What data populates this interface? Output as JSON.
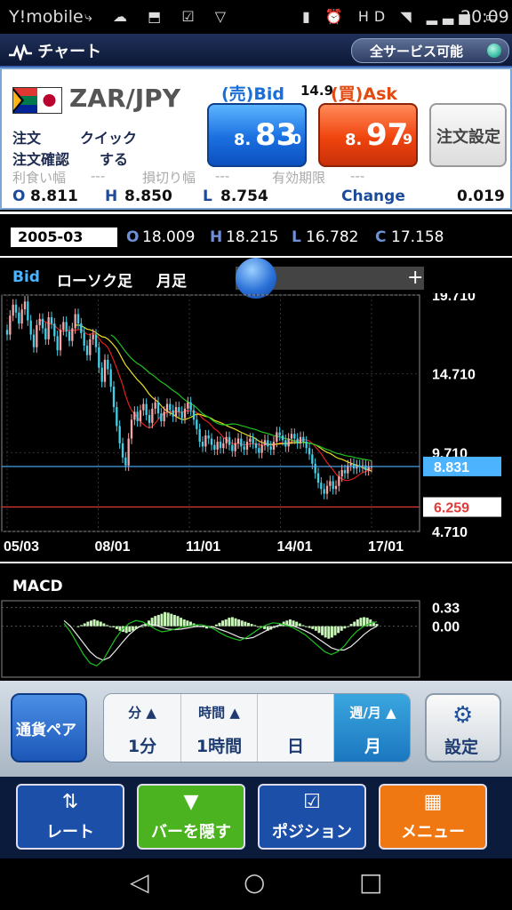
{
  "status_bar": {
    "carrier": "Y!mobile",
    "time": "20:09",
    "left_icons": "⤷ ☁ ⬒ ☑ ▽",
    "right_icons": "▮ ⏰ HD ◥ ▂▃▅ ▭"
  },
  "title_bar": {
    "title": "チャート",
    "service_status": "全サービス可能"
  },
  "quote": {
    "pair": "ZAR/JPY",
    "bid_label": "(売)Bid",
    "ask_label": "(買)Ask",
    "spread": "14.9",
    "bid_p1": "8.",
    "bid_p2": "83",
    "bid_p3": "0",
    "ask_p1": "8.",
    "ask_p2": "97",
    "ask_p3": "9",
    "order_settings": "注文設定",
    "order_label": "注文",
    "order_value": "クイック",
    "confirm_label": "注文確認",
    "confirm_value": "する",
    "takeprofit_label": "利食い幅",
    "takeprofit_value": "---",
    "stoploss_label": "損切り幅",
    "stoploss_value": "---",
    "expiry_label": "有効期限",
    "expiry_value": "---",
    "open_label": "O",
    "open": "8.811",
    "high_label": "H",
    "high": "8.850",
    "low_label": "L",
    "low": "8.754",
    "change_label": "Change",
    "change": "0.019"
  },
  "candle_info": {
    "date": "2005-03",
    "o_label": "O",
    "o": "18.009",
    "h_label": "H",
    "h": "18.215",
    "l_label": "L",
    "l": "16.782",
    "c_label": "C",
    "c": "17.158"
  },
  "chart_header": {
    "price_type": "Bid",
    "chart_type": "ローソク足",
    "period": "月足",
    "zoom_plus": "+"
  },
  "chart_data": [
    {
      "type": "candlestick",
      "title": "ZAR/JPY 月足",
      "x_ticks": [
        "05/03",
        "08/01",
        "11/01",
        "14/01",
        "17/01"
      ],
      "y_ticks": [
        "19.710",
        "14.710",
        "9.710",
        "4.710"
      ],
      "ylim": [
        4.71,
        19.71
      ],
      "current_price": "8.831",
      "marker_price": "6.259",
      "current_price_color": "#4cb4ff",
      "marker_price_color": "#e03a3a",
      "closes": [
        17.2,
        18.4,
        19.1,
        18.6,
        17.9,
        18.8,
        19.3,
        18.1,
        17.2,
        16.4,
        17.8,
        18.2,
        17.6,
        16.9,
        18.3,
        17.9,
        17.1,
        16.2,
        17.5,
        18.0,
        17.4,
        16.8,
        17.6,
        18.5,
        17.9,
        17.3,
        16.5,
        15.9,
        16.9,
        17.2,
        16.4,
        15.1,
        14.2,
        15.6,
        15.0,
        13.9,
        12.6,
        11.4,
        10.3,
        9.4,
        8.9,
        10.6,
        11.8,
        12.3,
        11.7,
        12.4,
        12.8,
        12.1,
        11.6,
        12.5,
        12.9,
        12.2,
        11.7,
        12.3,
        12.8,
        12.4,
        12.0,
        12.6,
        12.3,
        11.9,
        12.5,
        12.9,
        12.4,
        11.8,
        11.2,
        10.4,
        10.1,
        10.8,
        10.6,
        10.2,
        9.9,
        10.4,
        10.0,
        10.3,
        10.7,
        10.2,
        9.8,
        10.3,
        10.6,
        10.1,
        9.9,
        10.4,
        10.6,
        10.3,
        10.0,
        9.7,
        10.2,
        10.5,
        10.1,
        9.9,
        10.4,
        11.0,
        10.8,
        10.5,
        10.1,
        10.6,
        10.9,
        10.6,
        10.3,
        10.7,
        10.4,
        10.0,
        9.6,
        9.0,
        8.4,
        7.8,
        7.4,
        7.1,
        7.6,
        7.9,
        7.4,
        7.6,
        8.2,
        8.6,
        8.4,
        8.9,
        9.0,
        8.7,
        8.9,
        8.8,
        8.9,
        8.6,
        8.8,
        8.83
      ],
      "series": [
        {
          "name": "MA1",
          "color": "#e02020"
        },
        {
          "name": "MA2",
          "color": "#e8e020"
        },
        {
          "name": "MA3",
          "color": "#20c020"
        }
      ]
    },
    {
      "type": "macd",
      "title": "MACD",
      "y_ticks": [
        "0.33",
        "0.00"
      ],
      "ylim": [
        -0.9,
        0.45
      ],
      "histogram": [
        0.0,
        0.02,
        0.05,
        0.08,
        0.1,
        0.12,
        0.1,
        0.08,
        0.05,
        0.02,
        0.0,
        -0.02,
        -0.05,
        -0.08,
        -0.1,
        -0.12,
        -0.1,
        -0.08,
        -0.05,
        -0.02,
        0.0,
        0.05,
        0.1,
        0.15,
        0.18,
        0.2,
        0.22,
        0.25,
        0.24,
        0.22,
        0.2,
        0.18,
        0.15,
        0.12,
        0.1,
        0.08,
        0.05,
        0.03,
        0.0,
        -0.02,
        -0.04,
        -0.03,
        0.0,
        0.03,
        0.06,
        0.1,
        0.12,
        0.15,
        0.16,
        0.14,
        0.12,
        0.1,
        0.08,
        0.06,
        0.04,
        0.02,
        0.0,
        -0.02,
        -0.05,
        -0.08,
        -0.06,
        -0.03,
        0.0,
        0.04,
        0.08,
        0.1,
        0.12,
        0.1,
        0.08,
        0.05,
        0.02,
        0.0,
        -0.03,
        -0.05,
        -0.08,
        -0.12,
        -0.16,
        -0.2,
        -0.22,
        -0.2,
        -0.16,
        -0.12,
        -0.08,
        -0.04,
        0.0,
        0.04,
        0.08,
        0.12,
        0.15,
        0.16,
        0.15,
        0.12,
        0.08,
        0.04
      ],
      "macd_line": [
        0.05,
        -0.1,
        -0.3,
        -0.5,
        -0.65,
        -0.7,
        -0.6,
        -0.4,
        -0.2,
        -0.05,
        0.05,
        0.1,
        0.08,
        0.02,
        -0.05,
        -0.1,
        -0.08,
        -0.05,
        -0.02,
        0.0,
        0.02,
        0.03,
        0.0,
        -0.05,
        -0.12,
        -0.18,
        -0.22,
        -0.25,
        -0.2,
        -0.12,
        -0.04,
        0.02,
        0.06,
        0.05,
        0.02,
        -0.02,
        -0.08,
        -0.15,
        -0.25,
        -0.35,
        -0.45,
        -0.5,
        -0.45,
        -0.35,
        -0.2,
        -0.08,
        0.0,
        0.05,
        0.08
      ],
      "signal_line": [
        0.1,
        0.0,
        -0.15,
        -0.3,
        -0.45,
        -0.55,
        -0.6,
        -0.55,
        -0.42,
        -0.28,
        -0.15,
        -0.05,
        0.02,
        0.04,
        0.02,
        -0.02,
        -0.05,
        -0.06,
        -0.05,
        -0.03,
        -0.01,
        0.0,
        0.0,
        -0.02,
        -0.06,
        -0.1,
        -0.15,
        -0.2,
        -0.22,
        -0.2,
        -0.14,
        -0.08,
        -0.02,
        0.02,
        0.03,
        0.01,
        -0.03,
        -0.08,
        -0.14,
        -0.22,
        -0.3,
        -0.38,
        -0.42,
        -0.42,
        -0.36,
        -0.26,
        -0.15,
        -0.06,
        0.0
      ],
      "hist_color": "#c8f5b8",
      "macd_color": "#20c020",
      "signal_color": "#e8e8e8"
    }
  ],
  "macd_label": "MACD",
  "controls": {
    "pair_button": "通貨ペア",
    "segments": [
      {
        "top": "分 ▲",
        "bottom": "1分"
      },
      {
        "top": "時間 ▲",
        "bottom": "1時間"
      },
      {
        "top": "",
        "bottom": "日"
      },
      {
        "top": "週/月 ▲",
        "bottom": "月"
      }
    ],
    "settings_button": "設定"
  },
  "tabs": [
    {
      "icon": "⇅",
      "label": "レート",
      "color": "#1c4fa8"
    },
    {
      "icon": "▼",
      "label": "バーを隠す",
      "color": "#4bb31f"
    },
    {
      "icon": "☑",
      "label": "ポジション",
      "color": "#1c4fa8"
    },
    {
      "icon": "▦",
      "label": "メニュー",
      "color": "#f07812"
    }
  ],
  "system_nav": {
    "back": "◁",
    "home": "○",
    "recent": "□"
  }
}
